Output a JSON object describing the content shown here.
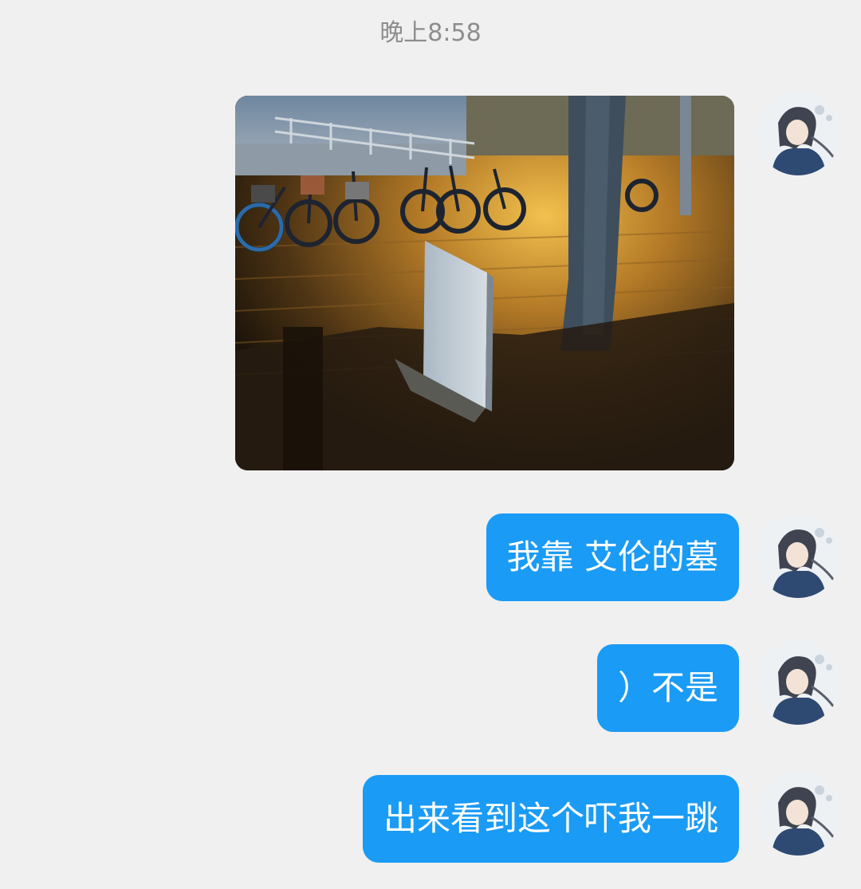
{
  "chat": {
    "timestamp": "晚上8:58",
    "messages": [
      {
        "type": "image",
        "icon": "photo-night-tombstone"
      },
      {
        "type": "text",
        "text": "我靠 艾伦的墓"
      },
      {
        "type": "text",
        "text": "）不是"
      },
      {
        "type": "text",
        "text": "出来看到这个吓我一跳"
      }
    ]
  },
  "colors": {
    "background": "#f0f0f0",
    "bubble": "#1a9bf5",
    "bubble_text": "#ffffff",
    "timestamp_text": "#8d8d8d"
  }
}
